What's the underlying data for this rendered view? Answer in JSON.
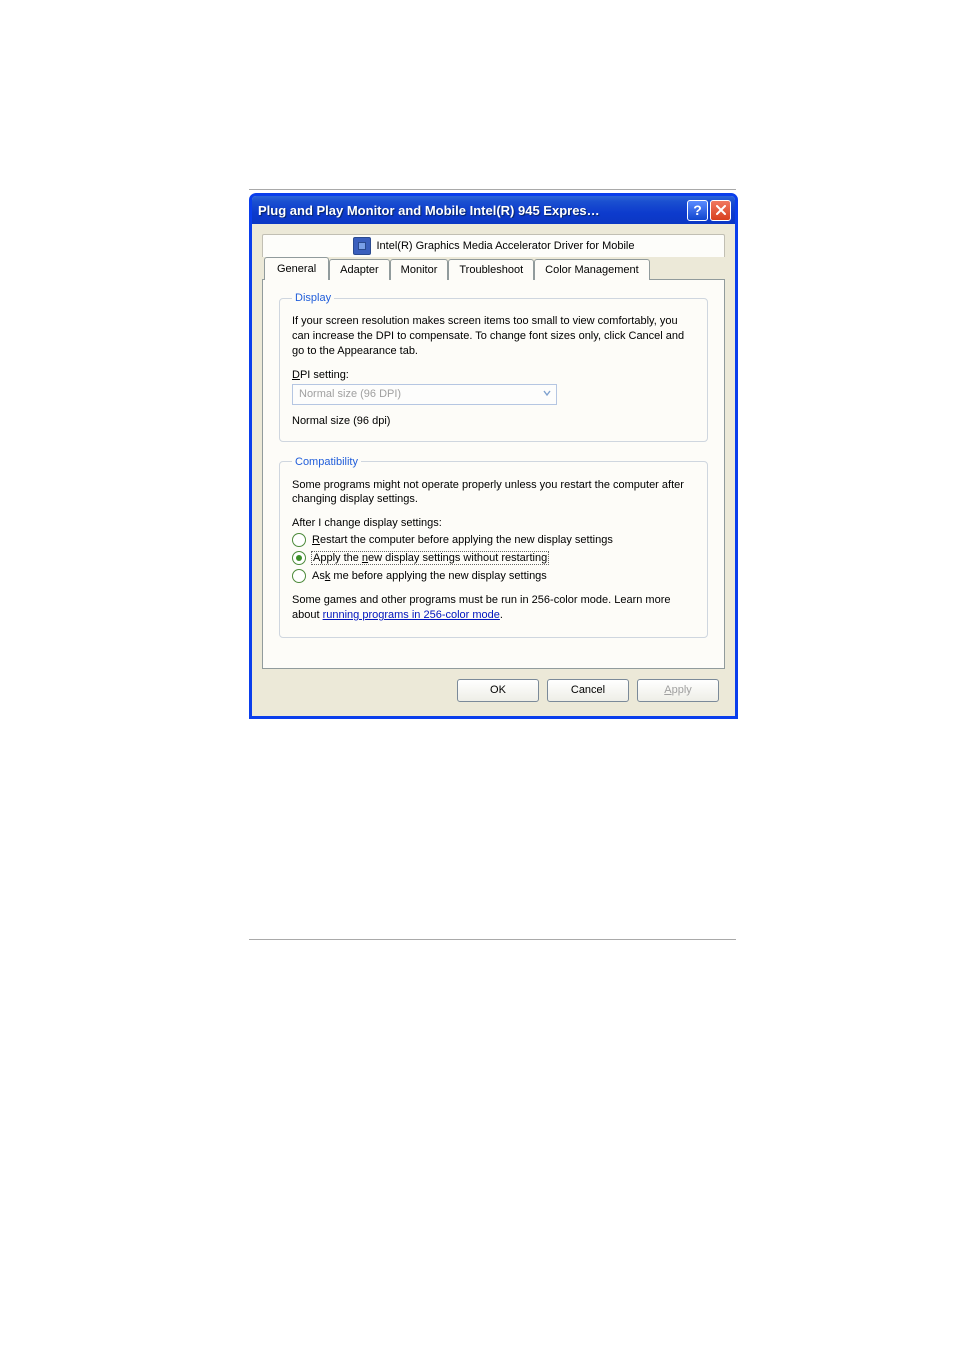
{
  "window": {
    "title": "Plug and Play Monitor and Mobile Intel(R) 945 Expres…"
  },
  "upper_link": {
    "label": "Intel(R) Graphics Media Accelerator Driver for Mobile",
    "icon": "intel-driver-icon"
  },
  "tabs": {
    "items": [
      {
        "label": "General"
      },
      {
        "label": "Adapter"
      },
      {
        "label": "Monitor"
      },
      {
        "label": "Troubleshoot"
      },
      {
        "label": "Color Management"
      }
    ],
    "active_index": 0
  },
  "display_group": {
    "legend": "Display",
    "intro": "If your screen resolution makes screen items too small to view comfortably, you can increase the DPI to compensate.  To change font sizes only, click Cancel and go to the Appearance tab.",
    "dpi_label_pre": "D",
    "dpi_label_post": "PI setting:",
    "dpi_combo_value": "Normal size (96 DPI)",
    "dpi_readout": "Normal size (96 dpi)"
  },
  "compat_group": {
    "legend": "Compatibility",
    "intro": "Some programs might not operate properly unless you restart the computer after changing display settings.",
    "after_label": "After I change display settings:",
    "radios": [
      {
        "pre": "R",
        "post": "estart the computer before applying the new display settings",
        "checked": false
      },
      {
        "pre": "Apply the ",
        "u": "n",
        "post": "ew display settings without restarting",
        "checked": true
      },
      {
        "pre": "As",
        "u": "k",
        "post": " me before applying the new display settings",
        "checked": false
      }
    ],
    "note_pre": "Some games and other programs must be run in 256-color mode. Learn more about ",
    "note_link": "running programs in 256-color mode",
    "note_post": "."
  },
  "buttons": {
    "ok": "OK",
    "cancel": "Cancel",
    "apply_pre": "A",
    "apply_post": "pply"
  }
}
